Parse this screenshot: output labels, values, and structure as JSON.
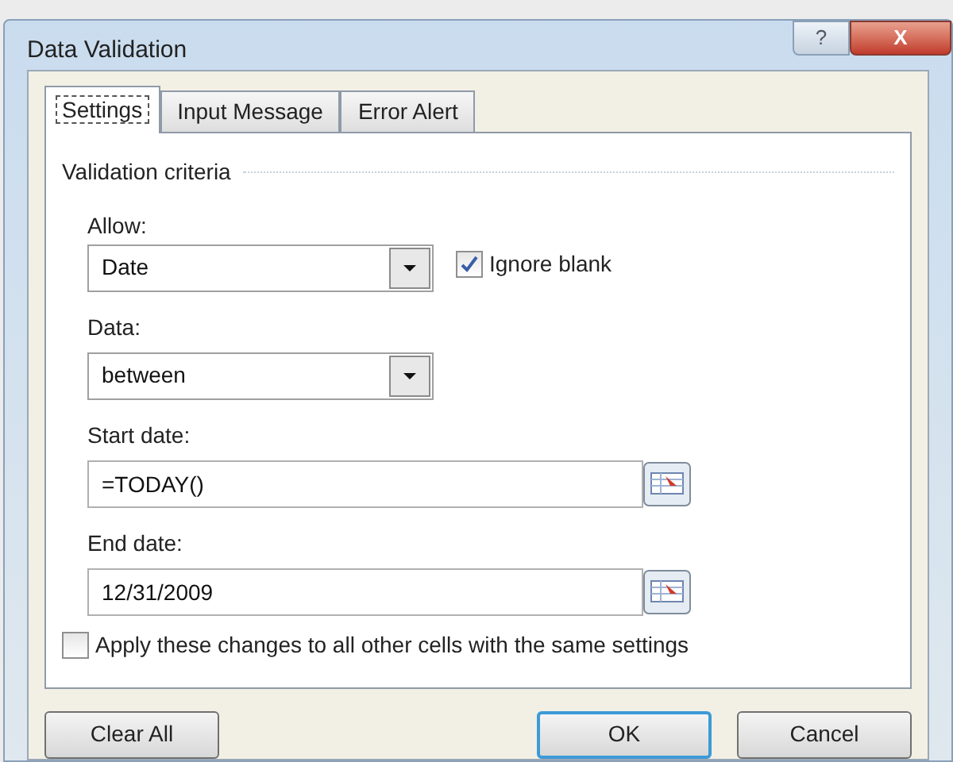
{
  "window": {
    "title": "Data Validation",
    "controls": [
      {
        "kind": "help",
        "label": "?"
      },
      {
        "kind": "close",
        "label": "X"
      }
    ]
  },
  "tabs": [
    {
      "label": "Settings",
      "selected": true
    },
    {
      "label": "Input Message",
      "selected": false
    },
    {
      "label": "Error Alert",
      "selected": false
    }
  ],
  "section": "Validation criteria",
  "allow": {
    "label": "Allow:",
    "value": "Date"
  },
  "ignore_blank": {
    "label": "Ignore blank",
    "checked": true
  },
  "data": {
    "label": "Data:",
    "value": "between"
  },
  "start_date": {
    "label": "Start date:",
    "value": "=TODAY()"
  },
  "end_date": {
    "label": "End date:",
    "value": "12/31/2009"
  },
  "apply_all": {
    "label": "Apply these changes to all other cells with the same settings",
    "checked": false
  },
  "buttons": [
    {
      "label": "Clear All",
      "kind": "left"
    },
    {
      "label": "OK",
      "kind": "default"
    },
    {
      "label": "Cancel",
      "kind": "normal"
    }
  ]
}
